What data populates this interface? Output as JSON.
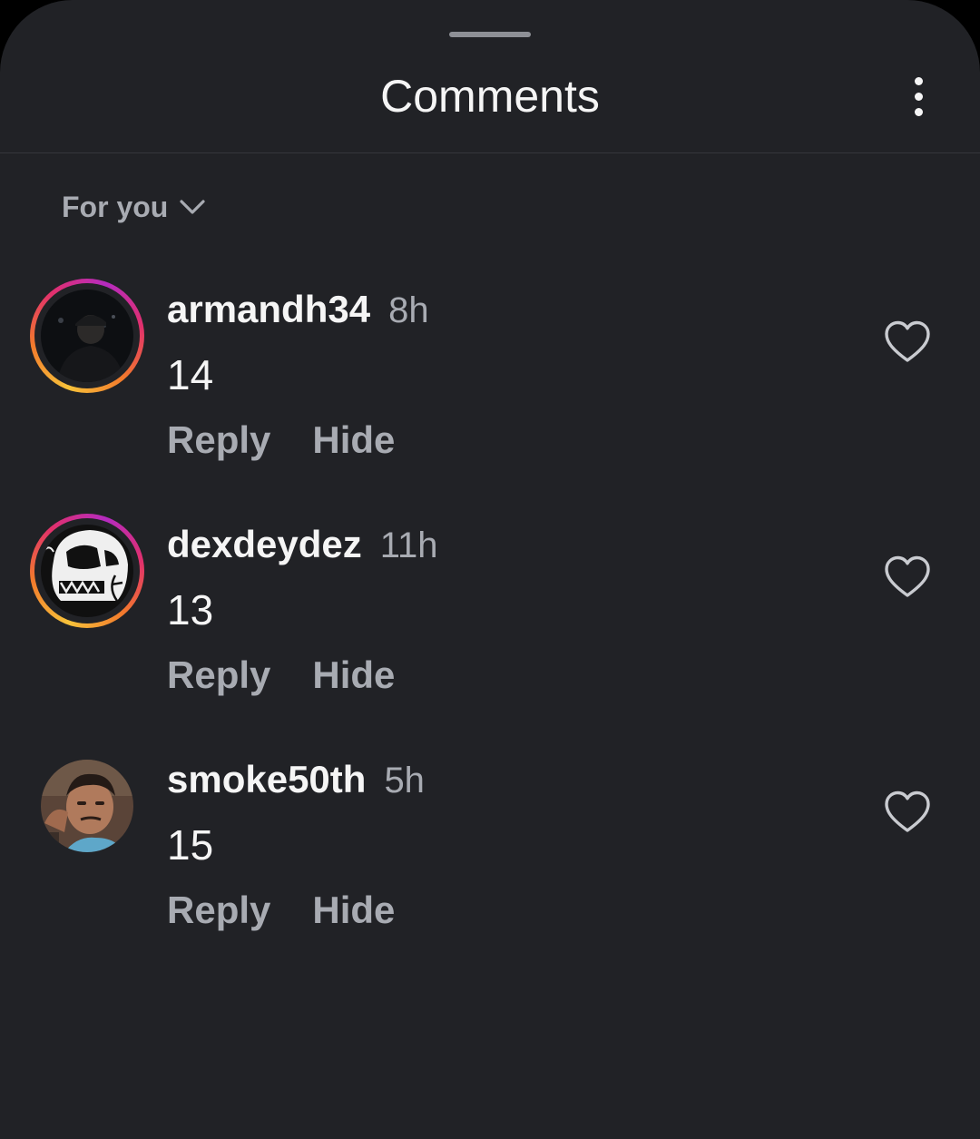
{
  "header": {
    "title": "Comments",
    "more_icon": "more-vertical-icon"
  },
  "sort": {
    "label": "For you",
    "icon": "chevron-down-icon"
  },
  "comments": [
    {
      "username": "armandh34",
      "time": "8h",
      "text": "14",
      "has_story_ring": true,
      "reply_label": "Reply",
      "hide_label": "Hide",
      "like_icon": "heart-outline-icon"
    },
    {
      "username": "dexdeydez",
      "time": "11h",
      "text": "13",
      "has_story_ring": true,
      "reply_label": "Reply",
      "hide_label": "Hide",
      "like_icon": "heart-outline-icon"
    },
    {
      "username": "smoke50th",
      "time": "5h",
      "text": "15",
      "has_story_ring": false,
      "reply_label": "Reply",
      "hide_label": "Hide",
      "like_icon": "heart-outline-icon"
    }
  ],
  "colors": {
    "background": "#212226",
    "primary_text": "#f5f5f5",
    "secondary_text": "#a8abb2",
    "story_ring": [
      "#f7c23a",
      "#e1306c",
      "#b52bc0"
    ]
  }
}
